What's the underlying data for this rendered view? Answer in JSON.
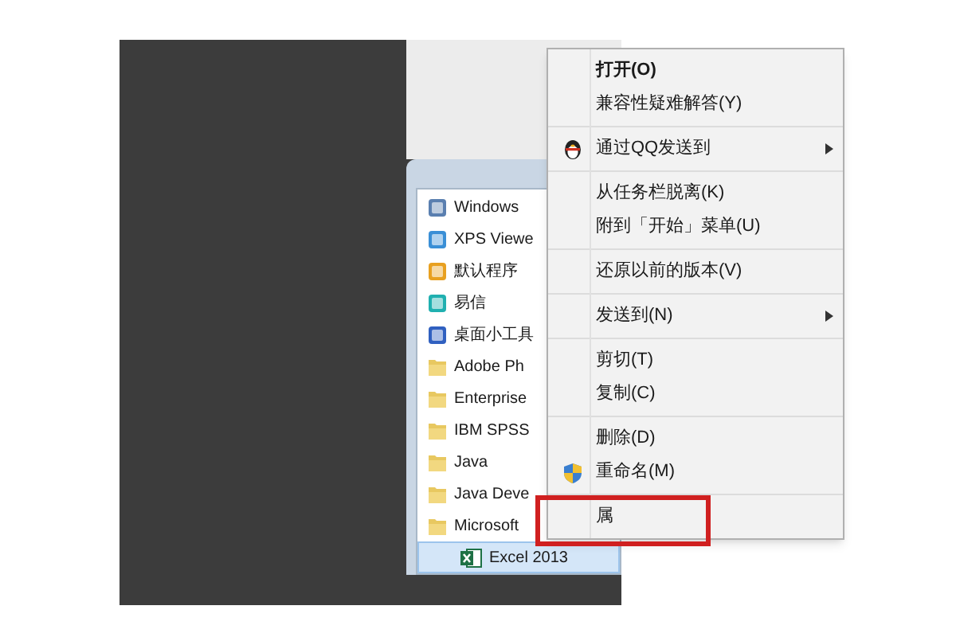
{
  "start_menu": {
    "items": [
      {
        "label": "Windows",
        "kind": "program",
        "selected": false
      },
      {
        "label": "XPS Viewe",
        "kind": "program",
        "selected": false
      },
      {
        "label": "默认程序",
        "kind": "program",
        "selected": false
      },
      {
        "label": "易信",
        "kind": "program",
        "selected": false
      },
      {
        "label": "桌面小工具",
        "kind": "program",
        "selected": false
      },
      {
        "label": "Adobe Ph",
        "kind": "folder",
        "selected": false
      },
      {
        "label": "Enterprise",
        "kind": "folder",
        "selected": false
      },
      {
        "label": "IBM SPSS",
        "kind": "folder",
        "selected": false
      },
      {
        "label": "Java",
        "kind": "folder",
        "selected": false
      },
      {
        "label": "Java Deve",
        "kind": "folder",
        "selected": false
      },
      {
        "label": "Microsoft",
        "kind": "folder",
        "selected": false,
        "children": [
          {
            "label": "Excel 2013",
            "kind": "spreadsheet",
            "selected": true
          }
        ]
      }
    ]
  },
  "context_menu": {
    "groups": [
      [
        {
          "label": "打开(O)",
          "bold": true,
          "submenu": false,
          "kind": "plain"
        },
        {
          "label": "兼容性疑难解答(Y)",
          "bold": false,
          "submenu": false,
          "kind": "plain"
        }
      ],
      [
        {
          "label": "通过QQ发送到",
          "bold": false,
          "submenu": true,
          "kind": "share"
        }
      ],
      [
        {
          "label": "从任务栏脱离(K)",
          "bold": false,
          "submenu": false,
          "kind": "plain"
        },
        {
          "label": "附到「开始」菜单(U)",
          "bold": false,
          "submenu": false,
          "kind": "plain"
        }
      ],
      [
        {
          "label": "还原以前的版本(V)",
          "bold": false,
          "submenu": false,
          "kind": "plain"
        }
      ],
      [
        {
          "label": "发送到(N)",
          "bold": false,
          "submenu": true,
          "kind": "plain"
        }
      ],
      [
        {
          "label": "剪切(T)",
          "bold": false,
          "submenu": false,
          "kind": "plain"
        },
        {
          "label": "复制(C)",
          "bold": false,
          "submenu": false,
          "kind": "plain"
        }
      ],
      [
        {
          "label": "删除(D)",
          "bold": false,
          "submenu": false,
          "kind": "plain"
        },
        {
          "label": "重命名(M)",
          "bold": false,
          "submenu": false,
          "kind": "admin"
        }
      ],
      [
        {
          "label": "属",
          "bold": false,
          "submenu": false,
          "kind": "plain"
        }
      ]
    ]
  }
}
